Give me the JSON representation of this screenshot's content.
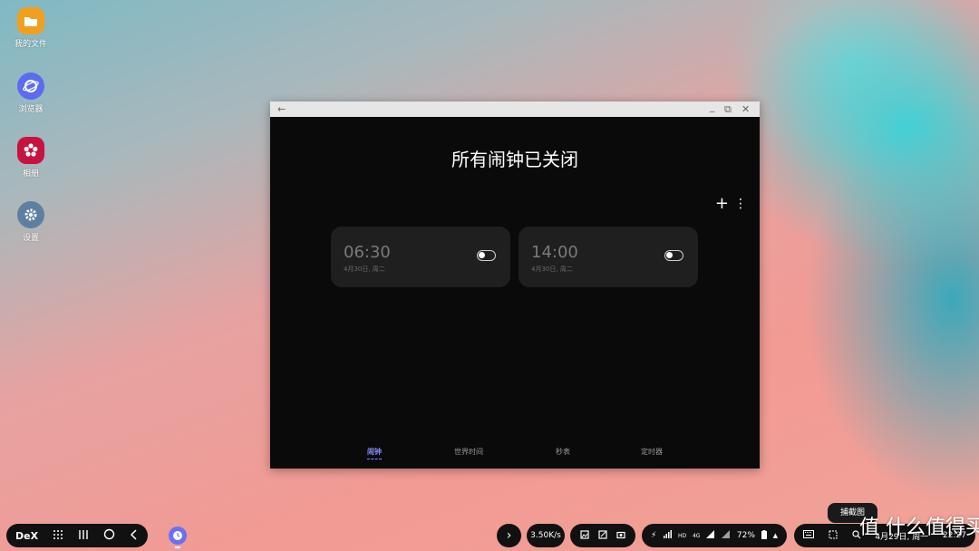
{
  "desktop": {
    "icons": [
      {
        "label": "我的文件",
        "icon": "folder-icon",
        "color": "#f0a020"
      },
      {
        "label": "浏览器",
        "icon": "browser-icon",
        "color": "#5b6cf0"
      },
      {
        "label": "相册",
        "icon": "gallery-icon",
        "color": "#c8123f"
      },
      {
        "label": "设置",
        "icon": "gear-icon",
        "color": "#5f7fa0"
      }
    ]
  },
  "window": {
    "titlebar": {
      "back": "←",
      "minimize": "_",
      "restore": "⧉",
      "close": "✕"
    },
    "heading": "所有闹钟已关闭",
    "add": "+",
    "more": "⋮",
    "alarms": [
      {
        "time": "06:30",
        "date": "4月30日, 周二",
        "enabled": false
      },
      {
        "time": "14:00",
        "date": "4月30日, 周二",
        "enabled": false
      }
    ],
    "tabs": [
      {
        "label": "闹钟",
        "active": true
      },
      {
        "label": "世界时间",
        "active": false
      },
      {
        "label": "秒表",
        "active": false
      },
      {
        "label": "定时器",
        "active": false
      }
    ]
  },
  "taskbar": {
    "dex": "DeX",
    "net_speed": "3.50K/s",
    "hd": "HD",
    "lte": "4G",
    "battery": "72%",
    "date": "4月29日, 周一",
    "time": "22:27",
    "expand": "›",
    "capture_tip": "捕截图"
  },
  "watermark": "值 什么值得买",
  "colors": {
    "accent": "#8a8dff",
    "window_bg": "#0a0a0a",
    "card_bg": "#1f1f1f"
  }
}
